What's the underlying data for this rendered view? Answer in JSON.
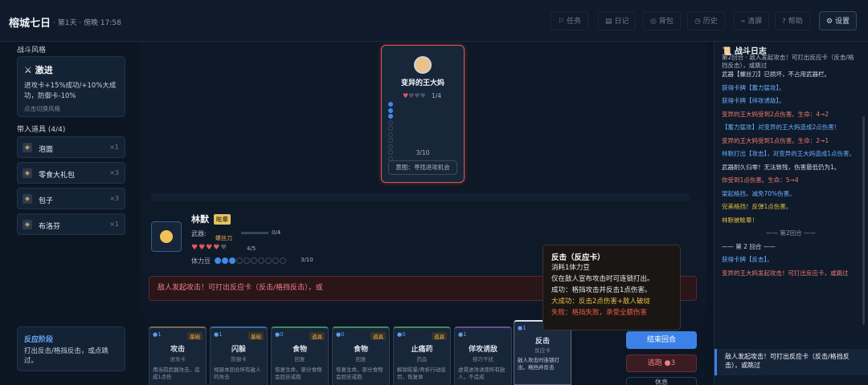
{
  "header": {
    "title": "榕城七日",
    "day": "· 第1天 · 傍晚 17:58",
    "nav": {
      "tasks": "任务",
      "diary": "日记",
      "bag": "背包",
      "history": "历史",
      "clear": "清屏",
      "help": "帮助",
      "settings": "设置"
    }
  },
  "sidebar": {
    "style_label": "战斗风格",
    "style_name": "⚔ 激进",
    "style_desc": "进攻卡+15%成功/+10%大成功，防御卡-10%",
    "style_hint": "点击切换风格",
    "items_label": "带入道具 (4/4)",
    "items": [
      {
        "name": "泡面",
        "count": "×1"
      },
      {
        "name": "零食大礼包",
        "count": "×3"
      },
      {
        "name": "包子",
        "count": "×3"
      },
      {
        "name": "布洛芬",
        "count": "×1"
      }
    ],
    "phase_title": "反应阶段",
    "phase_desc": "打出反击/格挡反击，或点跳过。"
  },
  "enemy": {
    "name": "变异的王大妈",
    "hp_text": "1/4",
    "hp": 1,
    "hp_max": 4,
    "stamina_text": "3/10",
    "stamina": 3,
    "stamina_max": 10,
    "intent": "意图：寻找进攻机会"
  },
  "player": {
    "name": "林默",
    "status": "眩晕",
    "weapon_label": "武器:",
    "weapon": "螺丝刀",
    "durability": "0/4",
    "hp_text": "4/5",
    "hp": 4,
    "hp_max": 5,
    "stamina_label": "体力豆",
    "stamina_text": "3/10",
    "stamina": 3,
    "stamina_max": 10
  },
  "alert": "敌人发起攻击！可打出反应卡（反击/格挡反击），或",
  "cards": [
    {
      "cost": "●1",
      "tag": "基础",
      "name": "攻击",
      "kind": "进攻卡",
      "desc": "用当前武器攻击，造成1点伤"
    },
    {
      "cost": "●1",
      "tag": "基础",
      "name": "闪躲",
      "kind": "防御卡",
      "desc": "规避本回合所有敌人的攻击"
    },
    {
      "cost": "●0",
      "tag": "道具",
      "name": "食物",
      "kind": "回复",
      "desc": "恢复生命，部分食物会回旦或抱"
    },
    {
      "cost": "●0",
      "tag": "道具",
      "name": "食物",
      "kind": "回复",
      "desc": "恢复生命，部分食物会回旦或抱"
    },
    {
      "cost": "●0",
      "tag": "道具",
      "name": "止痛药",
      "kind": "药品",
      "desc": "解除眩晕/骨折行动惩罚，恢复体"
    },
    {
      "cost": "●1",
      "tag": "",
      "name": "佯攻诱敌",
      "kind": "技巧干扰",
      "desc": "虚晃进攻诱使所有敌人，不造成"
    },
    {
      "cost": "●1",
      "tag": "",
      "name": "反击",
      "kind": "反应卡",
      "desc": "敌人攻击时连锁打出，格挡并反击"
    }
  ],
  "tooltip": {
    "title": "反击（反应卡）",
    "cost": "消耗1体力豆",
    "usage": "仅在敌人宣布攻击时可连锁打出。",
    "success": "成功：格挡攻击并反击1点伤害。",
    "great": "大成功：反击2点伤害+敌人破绽",
    "fail": "失败：格挡失败，承受全额伤害"
  },
  "buttons": {
    "end_turn": "结束回合",
    "flee": "逃跑 ●3",
    "rest": "休息"
  },
  "log": {
    "title": "📜 战斗日志",
    "subtitle": "第2回合 · 敌人发起攻击！可打出反应卡（反击/格挡反击），或跳过",
    "entries": [
      {
        "text": "武器【螺丝刀】已损坏，不占用武器栏。",
        "color": "white"
      },
      {
        "text": "获得卡牌【蓄力猛攻】。",
        "color": "blue"
      },
      {
        "text": "获得卡牌【佯攻诱敌】。",
        "color": "blue"
      },
      {
        "text": "变异的王大妈受到2点伤害。生命：4→2",
        "color": "red"
      },
      {
        "text": "【蓄力猛攻】对变异的王大妈造成2点伤害！",
        "color": "blue"
      },
      {
        "text": "变异的王大妈受到1点伤害。生命：2→1",
        "color": "red"
      },
      {
        "text": "林默打出【攻击】，对变异的王大妈造成1点伤害。",
        "color": "blue"
      },
      {
        "text": "武器耐久归零！无法致残，伤害最低仍为1。",
        "color": "white"
      },
      {
        "text": "你受到1点伤害。生命：5→4",
        "color": "red"
      },
      {
        "text": "架起格挡，减免70%伤害。",
        "color": "blue"
      },
      {
        "text": "完美格挡！反弹1点伤害。",
        "color": "yellow"
      },
      {
        "text": "林默被眩晕！",
        "color": "yellow"
      },
      {
        "text": "—— 第2回合 ——",
        "color": "gray"
      },
      {
        "text": "—— 第 2 回合 ——",
        "color": "white"
      },
      {
        "text": "获得卡牌【反击】。",
        "color": "blue"
      },
      {
        "text": "变异的王大妈发起攻击！可打出反应卡，或跳过",
        "color": "red"
      }
    ],
    "footer": "敌人发起攻击！可打出反应卡（反击/格挡反击），或跳过"
  }
}
